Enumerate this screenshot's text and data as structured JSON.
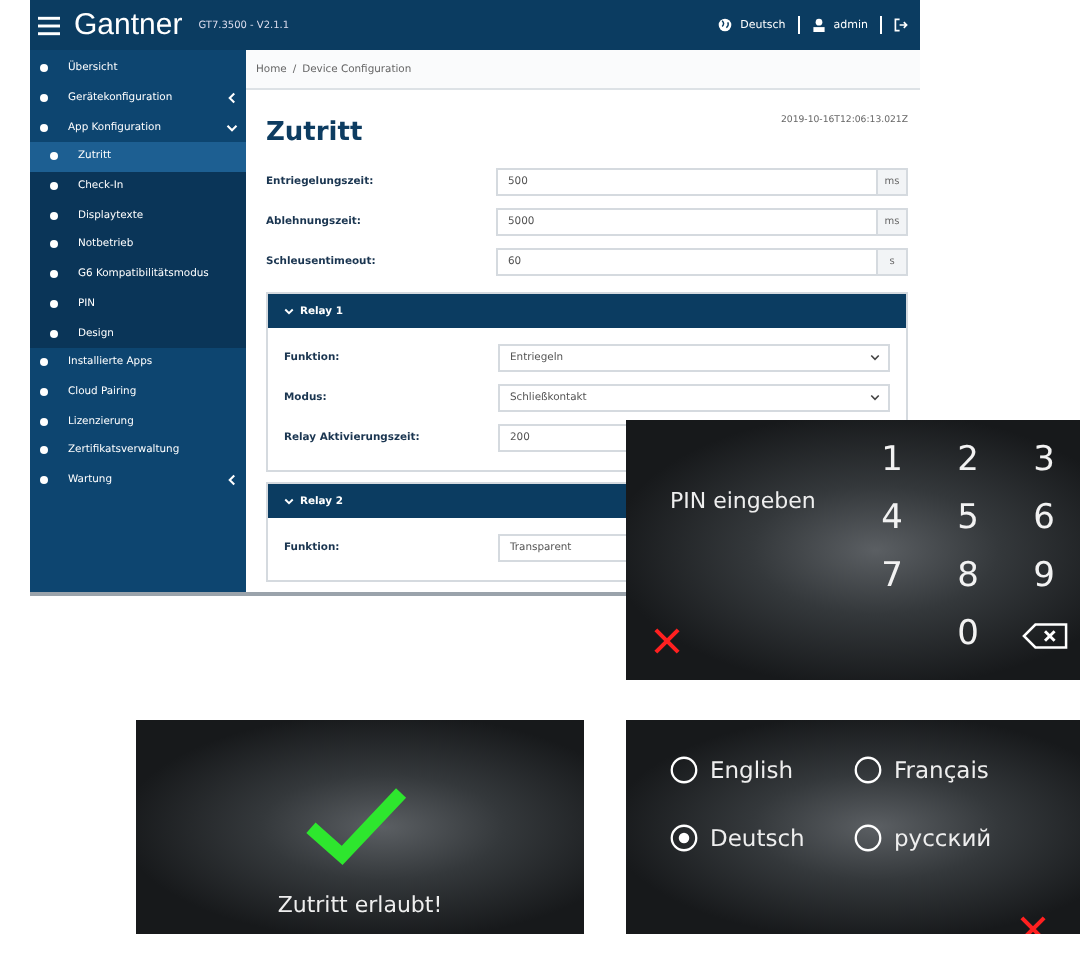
{
  "admin": {
    "brand": "Gantner",
    "version": "GT7.3500 - V2.1.1",
    "language": "Deutsch",
    "user": "admin",
    "sidebar": [
      {
        "label": "Übersicht",
        "kind": "link",
        "selected": false
      },
      {
        "label": "Gerätekonfiguration",
        "kind": "group",
        "expanded": false,
        "selected": false
      },
      {
        "label": "App Konfiguration",
        "kind": "group",
        "expanded": true,
        "selected": false,
        "children": [
          {
            "label": "Zutritt",
            "selected": true
          },
          {
            "label": "Check-In",
            "selected": false
          },
          {
            "label": "Displaytexte",
            "selected": false
          },
          {
            "label": "Notbetrieb",
            "selected": false
          },
          {
            "label": "G6 Kompatibilitätsmodus",
            "selected": false
          },
          {
            "label": "PIN",
            "selected": false
          },
          {
            "label": "Design",
            "selected": false
          }
        ]
      },
      {
        "label": "Installierte Apps",
        "kind": "link",
        "selected": false
      },
      {
        "label": "Cloud Pairing",
        "kind": "link",
        "selected": false
      },
      {
        "label": "Lizenzierung",
        "kind": "link",
        "selected": false
      },
      {
        "label": "Zertifikatsverwaltung",
        "kind": "link",
        "selected": false
      },
      {
        "label": "Wartung",
        "kind": "group",
        "expanded": false,
        "selected": false
      }
    ],
    "breadcrumb": {
      "items": [
        "Home",
        "Device Configuration"
      ],
      "separator": "/"
    },
    "title": "Zutritt",
    "timestamp": "2019-10-16T12:06:13.021Z",
    "fields": [
      {
        "label": "Entriegelungszeit:",
        "value": "500",
        "unit": "ms"
      },
      {
        "label": "Ablehnungszeit:",
        "value": "5000",
        "unit": "ms"
      },
      {
        "label": "Schleusentimeout:",
        "value": "60",
        "unit": "s"
      }
    ],
    "relays": [
      {
        "title": "Relay 1",
        "expanded": true,
        "rows": [
          {
            "label": "Funktion:",
            "value": "Entriegeln",
            "kind": "select"
          },
          {
            "label": "Modus:",
            "value": "Schließkontakt",
            "kind": "select"
          },
          {
            "label": "Relay Aktivierungszeit:",
            "value": "200",
            "kind": "input"
          }
        ]
      },
      {
        "title": "Relay 2",
        "expanded": true,
        "rows": [
          {
            "label": "Funktion:",
            "value": "Transparent",
            "kind": "select"
          }
        ]
      }
    ]
  },
  "pin_screen": {
    "prompt": "PIN eingeben",
    "keys": [
      "1",
      "2",
      "3",
      "4",
      "5",
      "6",
      "7",
      "8",
      "9",
      "0"
    ]
  },
  "access_screen": {
    "message": "Zutritt erlaubt!"
  },
  "language_screen": {
    "options": [
      {
        "label": "English",
        "selected": false
      },
      {
        "label": "Français",
        "selected": false
      },
      {
        "label": "Deutsch",
        "selected": true
      },
      {
        "label": "русский",
        "selected": false
      }
    ]
  }
}
